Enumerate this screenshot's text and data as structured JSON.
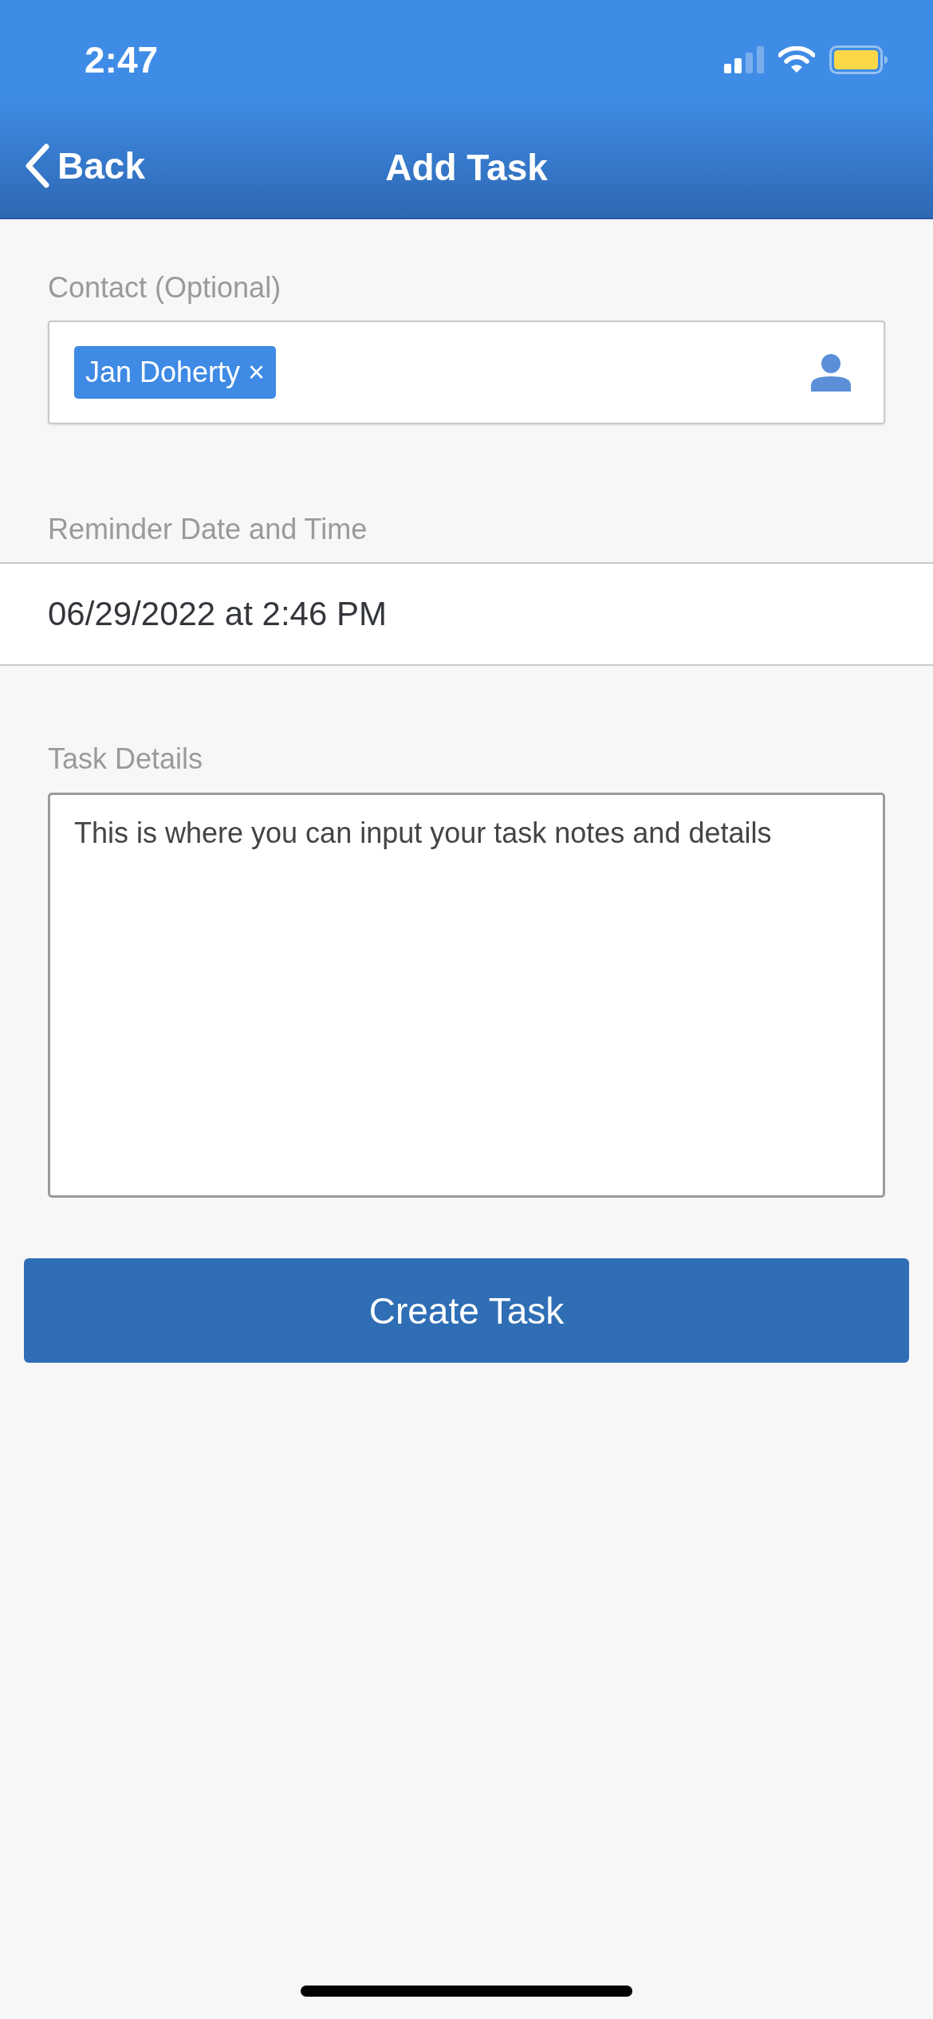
{
  "status_bar": {
    "time": "2:47"
  },
  "nav": {
    "back_label": "Back",
    "title": "Add Task"
  },
  "contact": {
    "label": "Contact (Optional)",
    "chips": [
      {
        "name": "Jan Doherty",
        "remove": "×"
      }
    ]
  },
  "reminder": {
    "label": "Reminder Date and Time",
    "value": "06/29/2022 at 2:46 PM"
  },
  "task_details": {
    "label": "Task Details",
    "placeholder": "This is where you can input your task notes and details"
  },
  "buttons": [
    {
      "label": "Create Task"
    }
  ]
}
